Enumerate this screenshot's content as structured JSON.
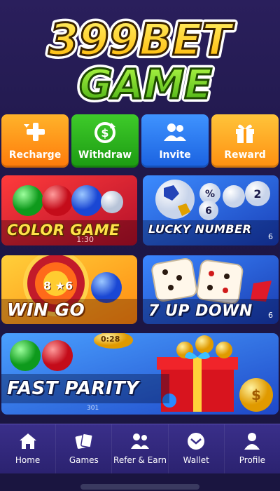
{
  "logo": {
    "line1": "399BET",
    "line2": "GAME"
  },
  "actions": [
    {
      "label": "Recharge",
      "icon": "plus-arrow-icon",
      "color": "#ff8c14"
    },
    {
      "label": "Withdraw",
      "icon": "withdraw-cycle-icon",
      "color": "#2bb01f"
    },
    {
      "label": "Invite",
      "icon": "people-icon",
      "color": "#2a76f0"
    },
    {
      "label": "Reward",
      "icon": "gift-icon",
      "color": "#ffa21f"
    }
  ],
  "games": [
    {
      "title": "COLOR GAME",
      "caption": "1:30"
    },
    {
      "title": "LUCKY NUMBER",
      "corner": "6"
    },
    {
      "title": "WIN GO",
      "wheel_text": "8 ★6"
    },
    {
      "title": "7 UP DOWN",
      "corner": "6"
    },
    {
      "title": "FAST PARITY",
      "timer": "0:28",
      "footer": "301"
    }
  ],
  "nav": [
    {
      "label": "Home",
      "icon": "home-icon"
    },
    {
      "label": "Games",
      "icon": "games-icon"
    },
    {
      "label": "Refer & Earn",
      "icon": "refer-icon"
    },
    {
      "label": "Wallet",
      "icon": "wallet-icon"
    },
    {
      "label": "Profile",
      "icon": "profile-icon"
    }
  ]
}
